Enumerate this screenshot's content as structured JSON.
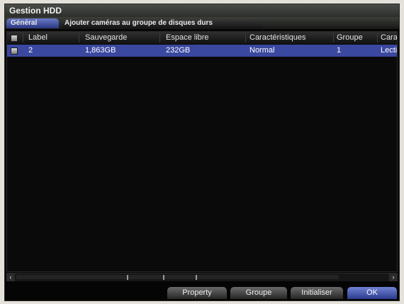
{
  "window": {
    "title": "Gestion HDD"
  },
  "tabs": [
    {
      "label": "Général",
      "active": true
    },
    {
      "label": "Ajouter caméras au groupe de disques durs",
      "active": false
    }
  ],
  "table": {
    "headers": [
      "Label",
      "Sauvegarde",
      "Espace libre",
      "Caractéristiques",
      "Groupe",
      "Cara"
    ],
    "rows": [
      {
        "label": "2",
        "sauvegarde": "1,863GB",
        "espace_libre": "232GB",
        "caracteristiques": "Normal",
        "groupe": "1",
        "cara": "Lecti"
      }
    ],
    "selected_row_color": "#3a48a0"
  },
  "scrollbar": {
    "left_arrow": "‹",
    "right_arrow": "›"
  },
  "buttons": {
    "property": "Property",
    "groupe": "Groupe",
    "initialiser": "Initialiser",
    "ok": "OK"
  },
  "colors": {
    "accent": "#3a48a0",
    "background": "#050505"
  }
}
